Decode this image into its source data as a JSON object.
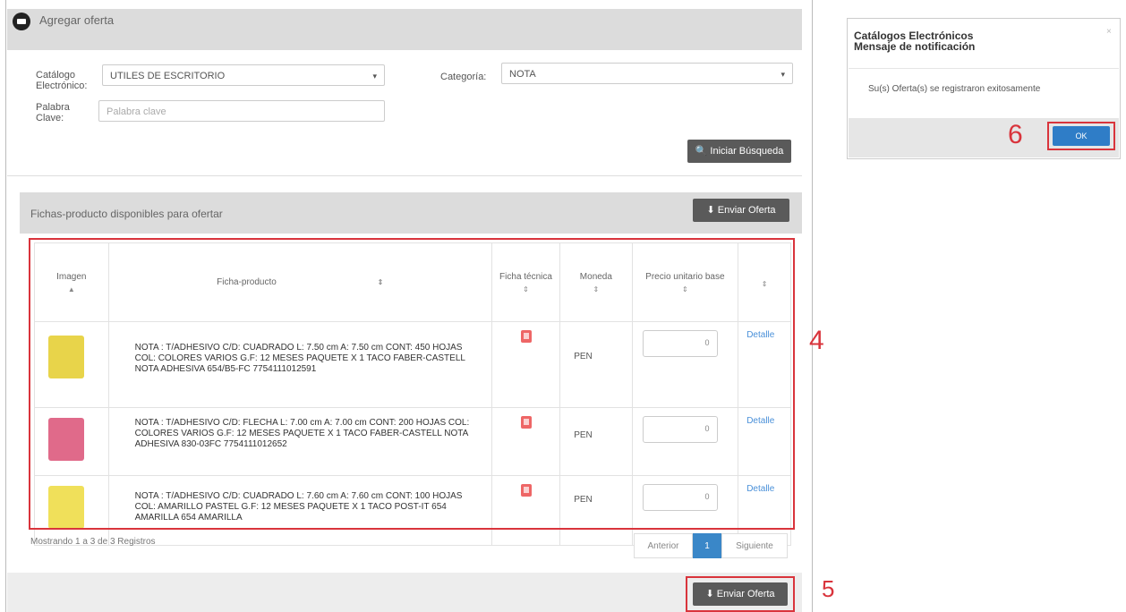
{
  "header": {
    "title": "Agregar oferta"
  },
  "search": {
    "catalog_label": "Catálogo Electrónico:",
    "catalog_value": "UTILES DE ESCRITORIO",
    "category_label": "Categoría:",
    "category_value": "NOTA",
    "keyword_label": "Palabra Clave:",
    "keyword_placeholder": "Palabra clave",
    "search_button": "Iniciar Búsqueda"
  },
  "products_panel": {
    "title": "Fichas-producto disponibles para ofertar",
    "send_offer_button": "Enviar Oferta",
    "columns": [
      "Imagen",
      "Ficha-producto",
      "Ficha técnica",
      "Moneda",
      "Precio unitario base",
      ""
    ],
    "rows": [
      {
        "description": "NOTA : T/ADHESIVO C/D: CUADRADO L: 7.50 cm A: 7.50 cm CONT: 450 HOJAS COL: COLORES VARIOS G.F: 12 MESES PAQUETE X 1 TACO FABER-CASTELL NOTA ADHESIVA 654/B5-FC 7754111012591",
        "currency": "PEN",
        "price_suffix": "0",
        "detail_link": "Detalle",
        "thumb_color": "#e8d44a"
      },
      {
        "description": "NOTA : T/ADHESIVO C/D: FLECHA L: 7.00 cm A: 7.00 cm CONT: 200 HOJAS COL: COLORES VARIOS G.F: 12 MESES PAQUETE X 1 TACO FABER-CASTELL NOTA ADHESIVA 830-03FC 7754111012652",
        "currency": "PEN",
        "price_suffix": "0",
        "detail_link": "Detalle",
        "thumb_color": "#e06a8a"
      },
      {
        "description": "NOTA : T/ADHESIVO C/D: CUADRADO L: 7.60 cm A: 7.60 cm CONT: 100 HOJAS COL: AMARILLO PASTEL G.F: 12 MESES PAQUETE X 1 TACO POST-IT 654 AMARILLA 654 AMARILLA",
        "currency": "PEN",
        "price_suffix": "0",
        "detail_link": "Detalle",
        "thumb_color": "#f0e05a"
      }
    ],
    "showing_text": "Mostrando 1 a 3 de 3 Registros",
    "pager": {
      "prev": "Anterior",
      "current": "1",
      "next": "Siguiente"
    }
  },
  "footer": {
    "send_offer_button": "Enviar Oferta"
  },
  "annotations": {
    "table": "4",
    "footer_button": "5",
    "ok_button": "6"
  },
  "dialog": {
    "title": "Catálogos Electrónicos",
    "subtitle": "Mensaje de notificación",
    "close": "×",
    "message": "Su(s) Oferta(s) se registraron exitosamente",
    "ok_button": "OK"
  },
  "colors": {
    "annotation_red": "#d9343c",
    "primary_blue": "#2f7dc7",
    "dark_button": "#5a5a5a"
  }
}
